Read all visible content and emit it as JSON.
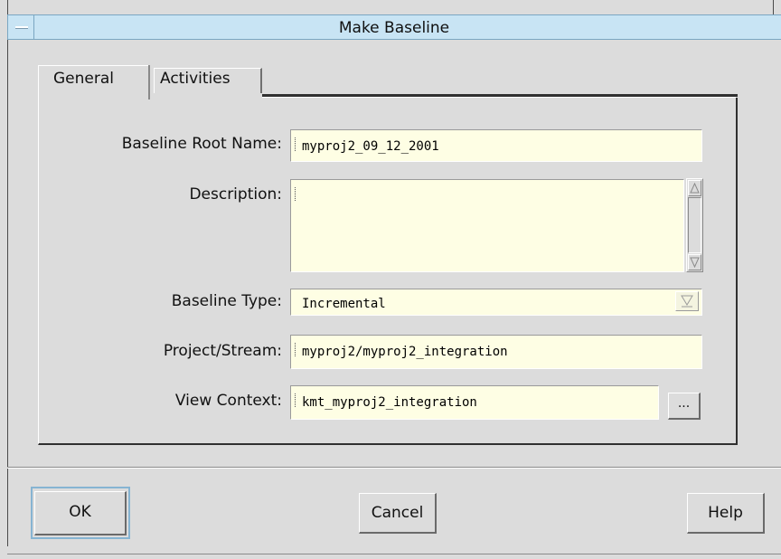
{
  "window": {
    "title": "Make Baseline",
    "system_menu_icon": "window-menu-icon"
  },
  "tabs": [
    {
      "label": "General",
      "selected": true
    },
    {
      "label": "Activities",
      "selected": false
    }
  ],
  "form": {
    "baseline_root_name": {
      "label": "Baseline Root Name:",
      "value": "myproj2_09_12_2001"
    },
    "description": {
      "label": "Description:",
      "value": ""
    },
    "baseline_type": {
      "label": "Baseline Type:",
      "value": "Incremental"
    },
    "project_stream": {
      "label": "Project/Stream:",
      "value": "myproj2/myproj2_integration"
    },
    "view_context": {
      "label": "View Context:",
      "value": "kmt_myproj2_integration",
      "browse_label": "..."
    }
  },
  "buttons": {
    "ok": "OK",
    "cancel": "Cancel",
    "help": "Help"
  },
  "colors": {
    "titlebar": "#c8e4f4",
    "field_bg": "#fefee4",
    "window_bg": "#dcdcdc",
    "focus_ring": "#86b4d2"
  }
}
